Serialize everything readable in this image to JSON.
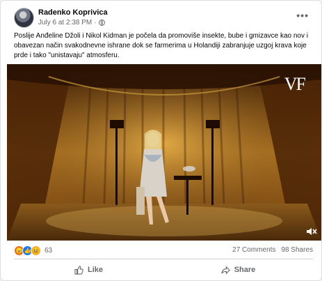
{
  "post": {
    "author": "Radenko Koprivica",
    "timestamp": "July 6 at 2:38 PM",
    "privacy_icon": "globe-icon",
    "more_icon": "ellipsis-icon",
    "more_label": "•••",
    "text": "Poslije Anđeline Džoli i Nikol Kidman je počela da promoviše insekte, bube i gmizavce kao nov i obavezan način svakodnevne ishrane dok se farmerima u Holandiji zabranjuje uzgoj krava koje prde i tako \"unistavaju\" atmosferu."
  },
  "media": {
    "watermark": "VF",
    "mute_icon": "speaker-muted-icon"
  },
  "stats": {
    "reactions": [
      "angry",
      "like",
      "haha"
    ],
    "reaction_count": "63",
    "comments": "27 Comments",
    "shares": "98 Shares"
  },
  "actions": {
    "like_label": "Like",
    "share_label": "Share"
  },
  "colors": {
    "secondary_text": "#65676b",
    "like_blue": "#1877f2",
    "angry_orange": "#e9710f",
    "haha_yellow": "#f7b125"
  }
}
